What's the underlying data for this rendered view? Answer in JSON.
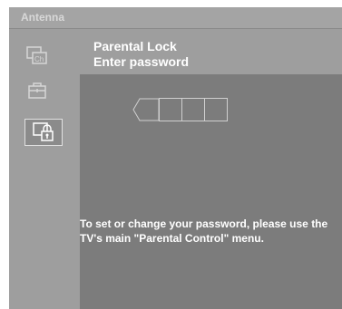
{
  "window": {
    "title": "Antenna"
  },
  "sidebar": {
    "items": [
      {
        "icon": "channel-list-icon",
        "label": "Ch",
        "selected": false
      },
      {
        "icon": "toolbox-icon",
        "selected": false
      },
      {
        "icon": "parental-lock-icon",
        "selected": true
      }
    ]
  },
  "header": {
    "title": "Parental Lock",
    "subtitle": "Enter password"
  },
  "pin": {
    "digits": [
      "",
      "",
      "",
      ""
    ]
  },
  "info": {
    "text": "To set or change your password, please use the TV's main \"Parental Control\" menu."
  },
  "colors": {
    "background": "#7c7c7c",
    "sidebar": "#9e9e9e",
    "title_bar": "#a4a4a4",
    "text": "#ffffff"
  }
}
